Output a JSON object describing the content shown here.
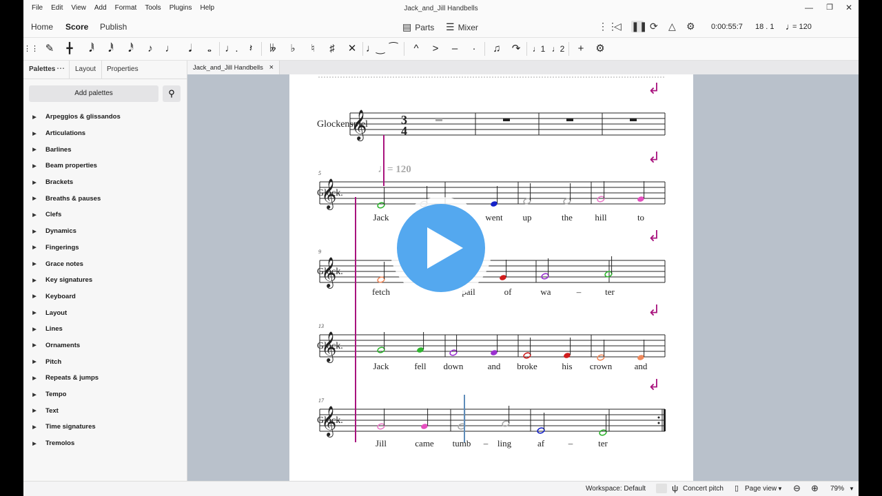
{
  "menubar": {
    "menus": [
      "File",
      "Edit",
      "View",
      "Add",
      "Format",
      "Tools",
      "Plugins",
      "Help"
    ],
    "title": "Jack_and_Jill Handbells"
  },
  "tabs": {
    "home": "Home",
    "score": "Score",
    "publish": "Publish"
  },
  "toolbar": {
    "parts": "Parts",
    "mixer": "Mixer",
    "time": "0:00:55:7",
    "position": "18 . 1",
    "tempo": "= 120"
  },
  "palettes": {
    "tabs": [
      "Palettes",
      "Layout",
      "Properties"
    ],
    "more": "⋯",
    "add_label": "Add palettes",
    "items": [
      "Arpeggios & glissandos",
      "Articulations",
      "Barlines",
      "Beam properties",
      "Brackets",
      "Breaths & pauses",
      "Clefs",
      "Dynamics",
      "Fingerings",
      "Grace notes",
      "Key signatures",
      "Keyboard",
      "Layout",
      "Lines",
      "Ornaments",
      "Pitch",
      "Repeats & jumps",
      "Tempo",
      "Text",
      "Time signatures",
      "Tremolos"
    ]
  },
  "document": {
    "tab": "Jack_and_Jill Handbells",
    "close": "×"
  },
  "score": {
    "instrument_full": "Glockenspiel",
    "instrument_short": "Glock.",
    "time_sig_top": "3",
    "time_sig_bottom": "4",
    "tempo_text": "= 120",
    "measure_numbers": [
      "5",
      "9",
      "13",
      "17"
    ],
    "lyrics": [
      [
        "Jack",
        "went",
        "up",
        "the",
        "hill",
        "to"
      ],
      [
        "fetch",
        "pail",
        "of",
        "wa",
        "–",
        "ter"
      ],
      [
        "Jack",
        "fell",
        "down",
        "and",
        "broke",
        "his",
        "crown",
        "and"
      ],
      [
        "Jill",
        "came",
        "tumb",
        "–",
        "ling",
        "af",
        "–",
        "ter"
      ]
    ]
  },
  "status": {
    "workspace": "Workspace: Default",
    "concert_pitch": "Concert pitch",
    "page_view": "Page view",
    "zoom": "79%"
  },
  "colors": {
    "accent_magenta": "#a8127d",
    "play_blue": "#54a8ef"
  }
}
